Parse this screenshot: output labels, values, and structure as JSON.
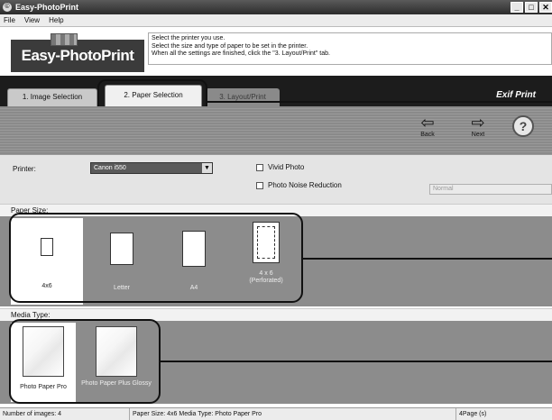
{
  "window": {
    "title": "Easy-PhotoPrint",
    "controls": [
      "_",
      "□",
      "✕"
    ]
  },
  "menu": [
    "File",
    "View",
    "Help"
  ],
  "header": {
    "logo": "Easy-PhotoPrint",
    "instructions": [
      "Select the printer you use.",
      "Select the size and type of paper to be set in the printer.",
      "When all the settings are finished, click the \"3. Layout/Print\" tab."
    ]
  },
  "tabs": [
    {
      "label": "1. Image Selection",
      "state": "inactive"
    },
    {
      "label": "2. Paper Selection",
      "state": "active"
    },
    {
      "label": "3. Layout/Print",
      "state": "disabled"
    }
  ],
  "brand_badge": "Exif Print",
  "nav": {
    "back": "Back",
    "next": "Next",
    "help": "?"
  },
  "settings": {
    "printer_label": "Printer:",
    "printer_value": "Canon i550",
    "vivid_photo": "Vivid Photo",
    "noise_reduction": "Photo Noise Reduction",
    "noise_level": "Normal"
  },
  "paper_size": {
    "header": "Paper Size:",
    "items": [
      {
        "label": "4x6",
        "selected": true
      },
      {
        "label": "Letter",
        "selected": false
      },
      {
        "label": "A4",
        "selected": false
      },
      {
        "label": "4 x 6\n(Perforated)",
        "selected": false
      }
    ]
  },
  "media_type": {
    "header": "Media Type:",
    "items": [
      {
        "label": "Photo Paper Pro",
        "selected": true
      },
      {
        "label": "Photo Paper Plus Glossy",
        "selected": false
      }
    ]
  },
  "status": {
    "images": "Number of images: 4",
    "paper": "Paper Size: 4x6  Media Type: Photo Paper Pro",
    "pages": "4Page (s)"
  }
}
